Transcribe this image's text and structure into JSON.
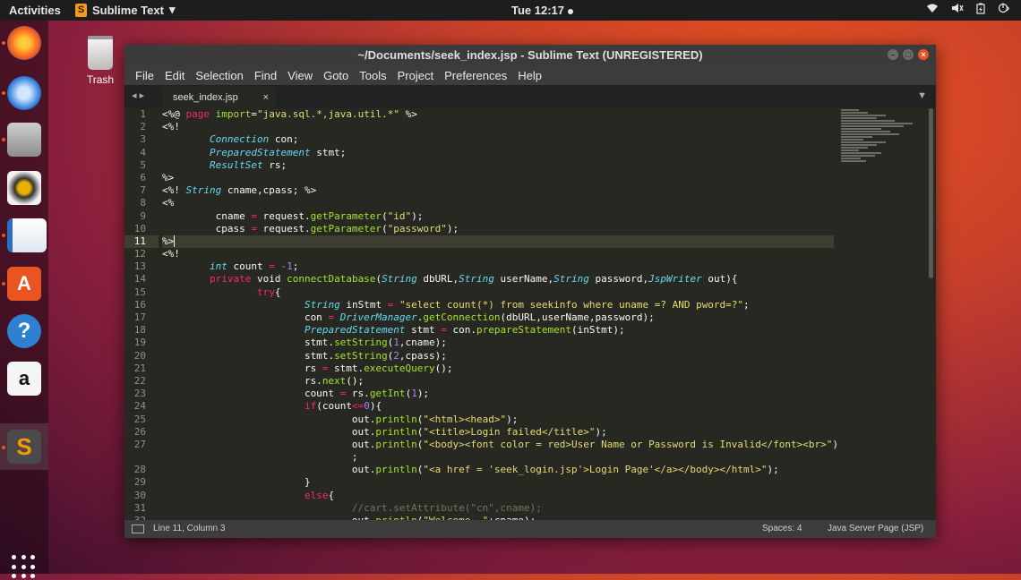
{
  "topbar": {
    "activities": "Activities",
    "app_name": "Sublime Text",
    "app_arrow": "▾",
    "clock": "Tue 12:17",
    "status_icons": [
      "wifi-icon",
      "volume-icon",
      "battery-icon",
      "power-icon"
    ]
  },
  "desktop": {
    "trash_label": "Trash"
  },
  "dock": {
    "items": [
      "firefox-icon",
      "thunderbird-icon",
      "files-icon",
      "rhythmbox-icon",
      "writer-icon",
      "software-center-icon",
      "help-icon",
      "amazon-icon",
      "sublime-text-icon"
    ],
    "accent_color": "#e95420"
  },
  "window": {
    "title": "~/Documents/seek_index.jsp - Sublime Text (UNREGISTERED)",
    "menu": [
      "File",
      "Edit",
      "Selection",
      "Find",
      "View",
      "Goto",
      "Tools",
      "Project",
      "Preferences",
      "Help"
    ],
    "tab": {
      "name": "seek_index.jsp",
      "close": "×"
    }
  },
  "colors": {
    "background": "#272822",
    "text": "#f8f8f2",
    "keyword": "#f92672",
    "type": "#66d9ef",
    "string": "#e6db74",
    "number": "#ae81ff",
    "function": "#a6e22e",
    "comment": "#75715e"
  },
  "editor": {
    "current_line": 11,
    "lines": [
      {
        "n": "1",
        "s": [
          [
            "<%@ ",
            ""
          ],
          [
            "page",
            "k"
          ],
          [
            " ",
            ""
          ],
          [
            "import",
            "f"
          ],
          [
            "=",
            ""
          ],
          [
            "\"java.sql.*,java.util.*\"",
            "s"
          ],
          [
            " %>",
            ""
          ]
        ]
      },
      {
        "n": "2",
        "s": [
          [
            "<%!",
            ""
          ]
        ]
      },
      {
        "n": "3",
        "s": [
          [
            "",
            ""
          ]
        ]
      },
      {
        "n": "3",
        "s": [
          [
            "        ",
            ""
          ],
          [
            "Connection",
            "t"
          ],
          [
            " con;",
            ""
          ]
        ]
      },
      {
        "n": "4",
        "s": [
          [
            "        ",
            ""
          ],
          [
            "PreparedStatement",
            "t"
          ],
          [
            " stmt;",
            ""
          ]
        ]
      },
      {
        "n": "5",
        "s": [
          [
            "        ",
            ""
          ],
          [
            "ResultSet",
            "t"
          ],
          [
            " rs;",
            ""
          ]
        ]
      },
      {
        "n": "6",
        "s": [
          [
            "%>",
            ""
          ]
        ]
      },
      {
        "n": "7",
        "s": [
          [
            "<%! ",
            ""
          ],
          [
            "String",
            "t"
          ],
          [
            " cname,cpass; %>",
            ""
          ]
        ]
      },
      {
        "n": "8",
        "s": [
          [
            "<%",
            ""
          ]
        ]
      },
      {
        "n": "9",
        "s": [
          [
            "         cname ",
            ""
          ],
          [
            "=",
            "k"
          ],
          [
            " request.",
            ""
          ],
          [
            "getParameter",
            "f"
          ],
          [
            "(",
            ""
          ],
          [
            "\"id\"",
            "s"
          ],
          [
            ");",
            ""
          ]
        ]
      },
      {
        "n": "10",
        "s": [
          [
            "         cpass ",
            ""
          ],
          [
            "=",
            "k"
          ],
          [
            " request.",
            ""
          ],
          [
            "getParameter",
            "f"
          ],
          [
            "(",
            ""
          ],
          [
            "\"password\"",
            "s"
          ],
          [
            ");",
            ""
          ]
        ]
      },
      {
        "n": "11",
        "s": [
          [
            "%>",
            ""
          ]
        ]
      },
      {
        "n": "12",
        "s": [
          [
            "<%!",
            ""
          ]
        ]
      },
      {
        "n": "13",
        "s": [
          [
            "        ",
            ""
          ],
          [
            "int",
            "t"
          ],
          [
            " count ",
            ""
          ],
          [
            "=",
            "k"
          ],
          [
            " ",
            ""
          ],
          [
            "-1",
            "n"
          ],
          [
            ";",
            ""
          ]
        ]
      },
      {
        "n": "14",
        "s": [
          [
            "        ",
            ""
          ],
          [
            "private",
            "k"
          ],
          [
            " void ",
            ""
          ],
          [
            "connectDatabase",
            "f"
          ],
          [
            "(",
            ""
          ],
          [
            "String",
            "t"
          ],
          [
            " dbURL,",
            ""
          ],
          [
            "String",
            "t"
          ],
          [
            " userName,",
            ""
          ],
          [
            "String",
            "t"
          ],
          [
            " password,",
            ""
          ],
          [
            "JspWriter",
            "t"
          ],
          [
            " out){",
            ""
          ]
        ]
      },
      {
        "n": "15",
        "s": [
          [
            "                ",
            ""
          ],
          [
            "try",
            "k"
          ],
          [
            "{",
            ""
          ]
        ]
      },
      {
        "n": "16",
        "s": [
          [
            "                        ",
            ""
          ],
          [
            "String",
            "t"
          ],
          [
            " inStmt ",
            ""
          ],
          [
            "=",
            "k"
          ],
          [
            " ",
            ""
          ],
          [
            "\"select count(*) from seekinfo where uname =? AND pword=?\"",
            "s"
          ],
          [
            ";",
            ""
          ]
        ]
      },
      {
        "n": "17",
        "s": [
          [
            "                        con ",
            ""
          ],
          [
            "=",
            "k"
          ],
          [
            " ",
            ""
          ],
          [
            "DriverManager",
            "t"
          ],
          [
            ".",
            ""
          ],
          [
            "getConnection",
            "f"
          ],
          [
            "(dbURL,userName,password);",
            ""
          ]
        ]
      },
      {
        "n": "18",
        "s": [
          [
            "                        ",
            ""
          ],
          [
            "PreparedStatement",
            "t"
          ],
          [
            " stmt ",
            ""
          ],
          [
            "=",
            "k"
          ],
          [
            " con.",
            ""
          ],
          [
            "prepareStatement",
            "f"
          ],
          [
            "(inStmt);",
            ""
          ]
        ]
      },
      {
        "n": "19",
        "s": [
          [
            "                        stmt.",
            ""
          ],
          [
            "setString",
            "f"
          ],
          [
            "(",
            ""
          ],
          [
            "1",
            "n"
          ],
          [
            ",cname);",
            ""
          ]
        ]
      },
      {
        "n": "20",
        "s": [
          [
            "                        stmt.",
            ""
          ],
          [
            "setString",
            "f"
          ],
          [
            "(",
            ""
          ],
          [
            "2",
            "n"
          ],
          [
            ",cpass);",
            ""
          ]
        ]
      },
      {
        "n": "21",
        "s": [
          [
            "                        rs ",
            ""
          ],
          [
            "=",
            "k"
          ],
          [
            " stmt.",
            ""
          ],
          [
            "executeQuery",
            "f"
          ],
          [
            "();",
            ""
          ]
        ]
      },
      {
        "n": "22",
        "s": [
          [
            "                        rs.",
            ""
          ],
          [
            "next",
            "f"
          ],
          [
            "();",
            ""
          ]
        ]
      },
      {
        "n": "23",
        "s": [
          [
            "                        count ",
            ""
          ],
          [
            "=",
            "k"
          ],
          [
            " rs.",
            ""
          ],
          [
            "getInt",
            "f"
          ],
          [
            "(",
            ""
          ],
          [
            "1",
            "n"
          ],
          [
            ");",
            ""
          ]
        ]
      },
      {
        "n": "24",
        "s": [
          [
            "                        ",
            ""
          ],
          [
            "if",
            "k"
          ],
          [
            "(count",
            ""
          ],
          [
            "<=",
            "k"
          ],
          [
            "0",
            "n"
          ],
          [
            "){",
            ""
          ]
        ]
      },
      {
        "n": "25",
        "s": [
          [
            "                                out.",
            ""
          ],
          [
            "println",
            "f"
          ],
          [
            "(",
            ""
          ],
          [
            "\"<html><head>\"",
            "s"
          ],
          [
            ");",
            ""
          ]
        ]
      },
      {
        "n": "26",
        "s": [
          [
            "                                out.",
            ""
          ],
          [
            "println",
            "f"
          ],
          [
            "(",
            ""
          ],
          [
            "\"<title>Login failed</title>\"",
            "s"
          ],
          [
            ");",
            ""
          ]
        ]
      },
      {
        "n": "27",
        "s": [
          [
            "                                out.",
            ""
          ],
          [
            "println",
            "f"
          ],
          [
            "(",
            ""
          ],
          [
            "\"<body><font color = red>User Name or Password is Invalid</font><br>\"",
            "s"
          ],
          [
            ")",
            ""
          ]
        ]
      },
      {
        "n": "",
        "s": [
          [
            "                                ;",
            ""
          ]
        ]
      },
      {
        "n": "28",
        "s": [
          [
            "                                out.",
            ""
          ],
          [
            "println",
            "f"
          ],
          [
            "(",
            ""
          ],
          [
            "\"<a href = 'seek_login.jsp'>Login Page'</a></body></html>\"",
            "s"
          ],
          [
            ");",
            ""
          ]
        ]
      },
      {
        "n": "29",
        "s": [
          [
            "                        }",
            ""
          ]
        ]
      },
      {
        "n": "30",
        "s": [
          [
            "                        ",
            ""
          ],
          [
            "else",
            "k"
          ],
          [
            "{",
            ""
          ]
        ]
      },
      {
        "n": "31",
        "s": [
          [
            "                                ",
            ""
          ],
          [
            "//cart.setAttribute(\"cn\",cname);",
            "c"
          ]
        ]
      },
      {
        "n": "32",
        "s": [
          [
            "                                out.",
            ""
          ],
          [
            "println",
            "f"
          ],
          [
            "(",
            ""
          ],
          [
            "\"Welcome, \"",
            "s"
          ],
          [
            "+cname);",
            ""
          ]
        ]
      }
    ]
  },
  "statusbar": {
    "position": "Line 11, Column 3",
    "spaces": "Spaces: 4",
    "syntax": "Java Server Page (JSP)"
  }
}
